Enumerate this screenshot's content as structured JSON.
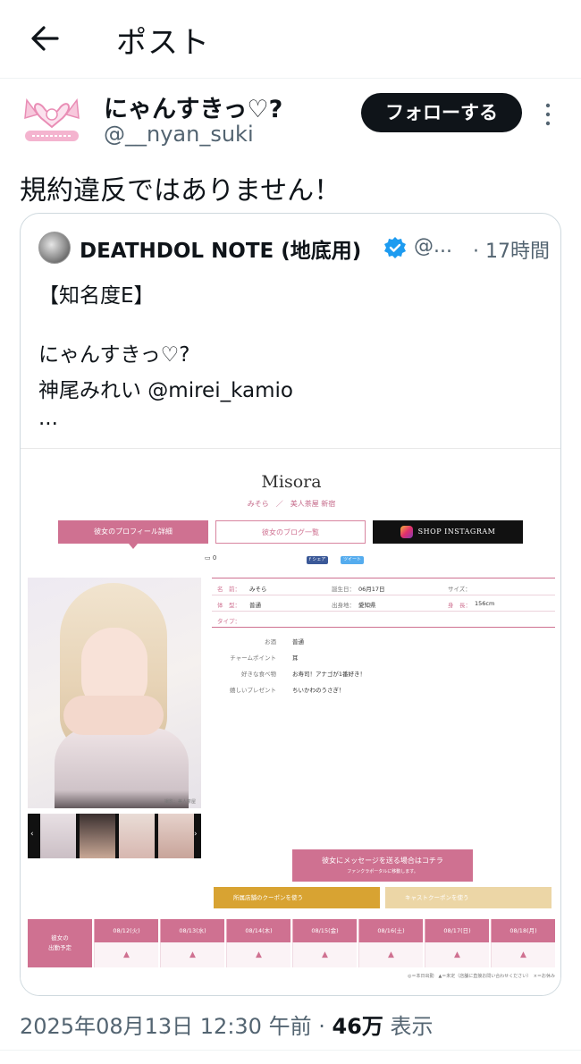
{
  "header": {
    "title": "ポスト"
  },
  "post": {
    "author_name": "にゃんすきっ♡?",
    "author_handle": "@__nyan_suki",
    "follow_label": "フォローする",
    "text": "規約違反ではありません！",
    "timestamp": "2025年08月13日 12:30 午前",
    "separator": " · ",
    "views_count": "46万",
    "views_label": " 表示"
  },
  "quote": {
    "author_name": "DEATHDOL NOTE (地底用)",
    "handle": "@...",
    "time": "· 17時間",
    "lines": [
      "【知名度E】",
      "にゃんすきっ♡?",
      "神尾みれい @mirei_kamio",
      "..."
    ]
  },
  "profile_page": {
    "name": "Misora",
    "subtitle": "みそら　／　美人茶屋 新宿",
    "btn_profile": "彼女のプロフィール詳細",
    "btn_blog": "彼女のブログ一覧",
    "btn_instagram": "SHOP INSTAGRAM",
    "count": "0",
    "share_fb": "f シェア",
    "share_tw": "ツイート",
    "photo_caption": "撮影：美人茶屋",
    "info": {
      "name_label": "名　前：",
      "name_value": "みそら",
      "birthday_label": "誕生日：",
      "birthday_value": "06月17日",
      "size_label": "サイズ：",
      "type_label": "体　型：",
      "type_value": "普通",
      "origin_label": "出身地：",
      "origin_value": "愛知県",
      "height_label": "身　長：",
      "height_value": "156cm",
      "tipe_label": "タイプ："
    },
    "details": [
      {
        "k": "お酒",
        "v": "普通"
      },
      {
        "k": "チャームポイント",
        "v": "耳"
      },
      {
        "k": "好きな食べ物",
        "v": "お寿司！アナゴが1番好き！"
      },
      {
        "k": "嬉しいプレゼント",
        "v": "ちいかわのうさぎ！"
      }
    ],
    "message_btn": "彼女にメッセージを送る場合はコチラ",
    "message_sub": "ファンクラポータルに移動します。",
    "coupon1": "所属店舗のクーポンを使う　　　　　　　　　　　　　　　　　>",
    "coupon2": "キャストクーポンを使う　　　　　　　　　　　　　　　　　>",
    "schedule_head": "彼女の\n出勤予定",
    "schedule": [
      {
        "day": "08/12(火)",
        "mark": "▲"
      },
      {
        "day": "08/13(水)",
        "mark": "▲"
      },
      {
        "day": "08/14(木)",
        "mark": "▲"
      },
      {
        "day": "08/15(金)",
        "mark": "▲"
      },
      {
        "day": "08/16(土)",
        "mark": "▲"
      },
      {
        "day": "08/17(日)",
        "mark": "▲"
      },
      {
        "day": "08/18(月)",
        "mark": "▲"
      }
    ],
    "legend": "◎＝本日出勤　▲＝未定（店舗に直接お問い合わせください）　×＝お休み"
  },
  "colors": {
    "accent": "#cf7191",
    "brand_dark": "#0f1419",
    "muted": "#536471",
    "verified": "#1d9bf0"
  }
}
